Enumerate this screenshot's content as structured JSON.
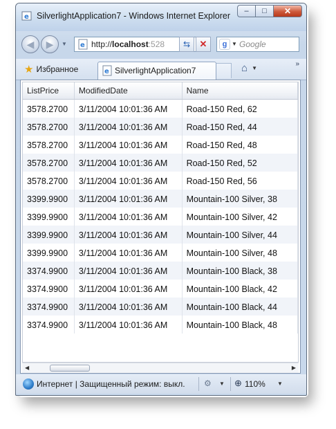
{
  "window": {
    "title": "SilverlightApplication7 - Windows Internet Explorer",
    "minimize_glyph": "–",
    "maximize_glyph": "□",
    "close_glyph": "✕"
  },
  "nav": {
    "back_glyph": "◀",
    "forward_glyph": "▶",
    "history_dropdown_glyph": "▼",
    "address_prefix": "http://",
    "address_host": "localhost",
    "address_rest": ":528",
    "address_dropdown_glyph": "▼",
    "refresh_glyph": "⇆",
    "stop_glyph": "✕",
    "search_engine_letter": "g",
    "search_dropdown_glyph": "▼",
    "search_placeholder": "Google"
  },
  "tabs": {
    "favorites_label": "Избранное",
    "favorites_glyph": "★",
    "active_tab_label": "SilverlightApplication7",
    "home_glyph": "⌂",
    "home_dropdown_glyph": "▼",
    "more_glyph": "»"
  },
  "grid": {
    "columns": [
      "ListPrice",
      "ModifiedDate",
      "Name"
    ],
    "rows": [
      [
        "3578.2700",
        "3/11/2004 10:01:36 AM",
        "Road-150 Red, 62"
      ],
      [
        "3578.2700",
        "3/11/2004 10:01:36 AM",
        "Road-150 Red, 44"
      ],
      [
        "3578.2700",
        "3/11/2004 10:01:36 AM",
        "Road-150 Red, 48"
      ],
      [
        "3578.2700",
        "3/11/2004 10:01:36 AM",
        "Road-150 Red, 52"
      ],
      [
        "3578.2700",
        "3/11/2004 10:01:36 AM",
        "Road-150 Red, 56"
      ],
      [
        "3399.9900",
        "3/11/2004 10:01:36 AM",
        "Mountain-100 Silver, 38"
      ],
      [
        "3399.9900",
        "3/11/2004 10:01:36 AM",
        "Mountain-100 Silver, 42"
      ],
      [
        "3399.9900",
        "3/11/2004 10:01:36 AM",
        "Mountain-100 Silver, 44"
      ],
      [
        "3399.9900",
        "3/11/2004 10:01:36 AM",
        "Mountain-100 Silver, 48"
      ],
      [
        "3374.9900",
        "3/11/2004 10:01:36 AM",
        "Mountain-100 Black, 38"
      ],
      [
        "3374.9900",
        "3/11/2004 10:01:36 AM",
        "Mountain-100 Black, 42"
      ],
      [
        "3374.9900",
        "3/11/2004 10:01:36 AM",
        "Mountain-100 Black, 44"
      ],
      [
        "3374.9900",
        "3/11/2004 10:01:36 AM",
        "Mountain-100 Black, 48"
      ]
    ],
    "scroll_left_glyph": "◀",
    "scroll_right_glyph": "▶"
  },
  "status": {
    "text": "Интернет | Защищенный режим: выкл.",
    "security_glyph": "⚙",
    "security_dropdown_glyph": "▼",
    "zoom_glyph": "⊕",
    "zoom_level": "110%",
    "zoom_dropdown_glyph": "▼"
  },
  "colors": {
    "window_frame": "#c7d7ea",
    "close_button": "#cd5a3c",
    "row_alt": "#f1f4f9",
    "link_blue": "#2760b3"
  }
}
